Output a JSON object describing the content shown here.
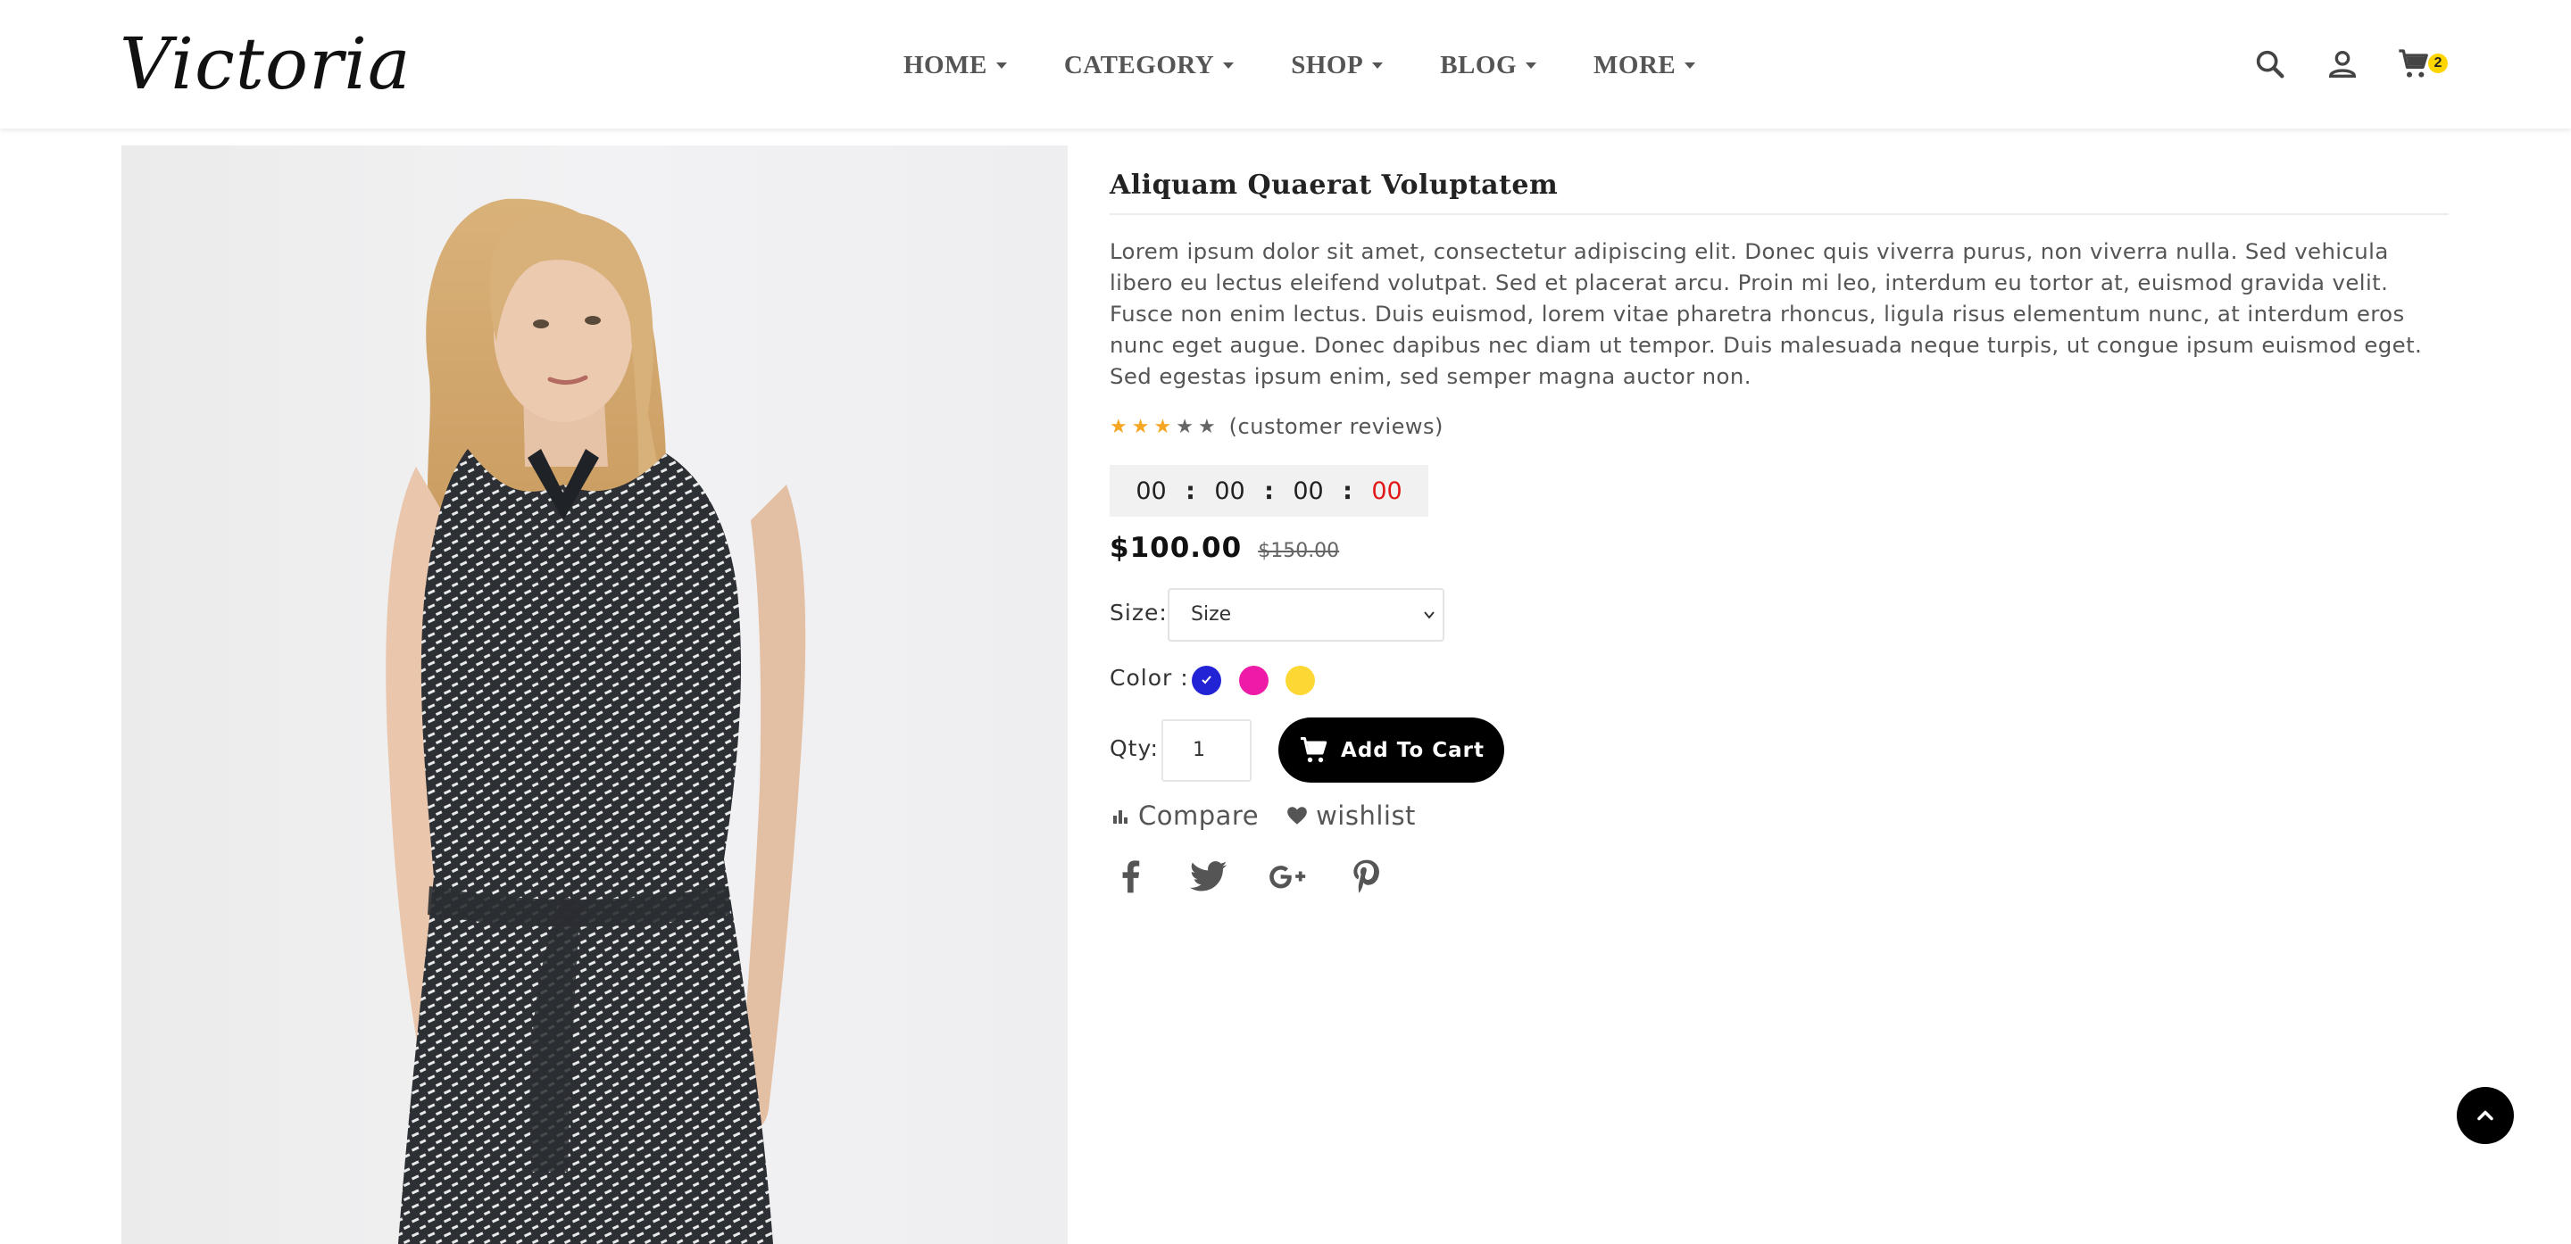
{
  "header": {
    "logo_text": "Victoria",
    "nav": [
      {
        "label": "HOME"
      },
      {
        "label": "CATEGORY"
      },
      {
        "label": "SHOP"
      },
      {
        "label": "BLOG"
      },
      {
        "label": "MORE"
      }
    ],
    "icons": [
      "search-icon",
      "user-icon",
      "cart-icon"
    ],
    "cart_count": "2"
  },
  "product": {
    "title": "Aliquam Quaerat Voluptatem",
    "description": "Lorem ipsum dolor sit amet, consectetur adipiscing elit. Donec quis viverra purus, non viverra nulla. Sed vehicula libero eu lectus eleifend volutpat. Sed et placerat arcu. Proin mi leo, interdum eu tortor at, euismod gravida velit. Fusce non enim lectus. Duis euismod, lorem vitae pharetra rhoncus, ligula risus elementum nunc, at interdum eros nunc eget augue. Donec dapibus nec diam ut tempor. Duis malesuada neque turpis, ut congue ipsum euismod eget. Sed egestas ipsum enim, sed semper magna auctor non.",
    "rating": {
      "stars_filled": 3,
      "stars_total": 5,
      "reviews_text": "(customer reviews)"
    },
    "countdown": {
      "days": "00",
      "hours": "00",
      "minutes": "00",
      "seconds": "00",
      "separator": ":"
    },
    "price": {
      "current": "$100.00",
      "old": "$150.00"
    },
    "size": {
      "label": "Size:",
      "selected": "Size"
    },
    "color": {
      "label": "Color :",
      "swatches": [
        {
          "name": "blue",
          "hex": "#2323d6",
          "selected": true
        },
        {
          "name": "pink",
          "hex": "#ee1aa8",
          "selected": false
        },
        {
          "name": "yellow",
          "hex": "#fdd835",
          "selected": false
        }
      ]
    },
    "qty": {
      "label": "Qty:",
      "value": "1"
    },
    "add_to_cart_label": "Add To Cart",
    "compare_label": "Compare",
    "wishlist_label": "wishlist",
    "social": [
      "facebook-icon",
      "twitter-icon",
      "google-plus-icon",
      "pinterest-icon"
    ]
  },
  "colors": {
    "accent_star": "#f5a623",
    "timer_red": "#e01818",
    "cart_badge": "#ffd500",
    "button_bg": "#000000"
  }
}
